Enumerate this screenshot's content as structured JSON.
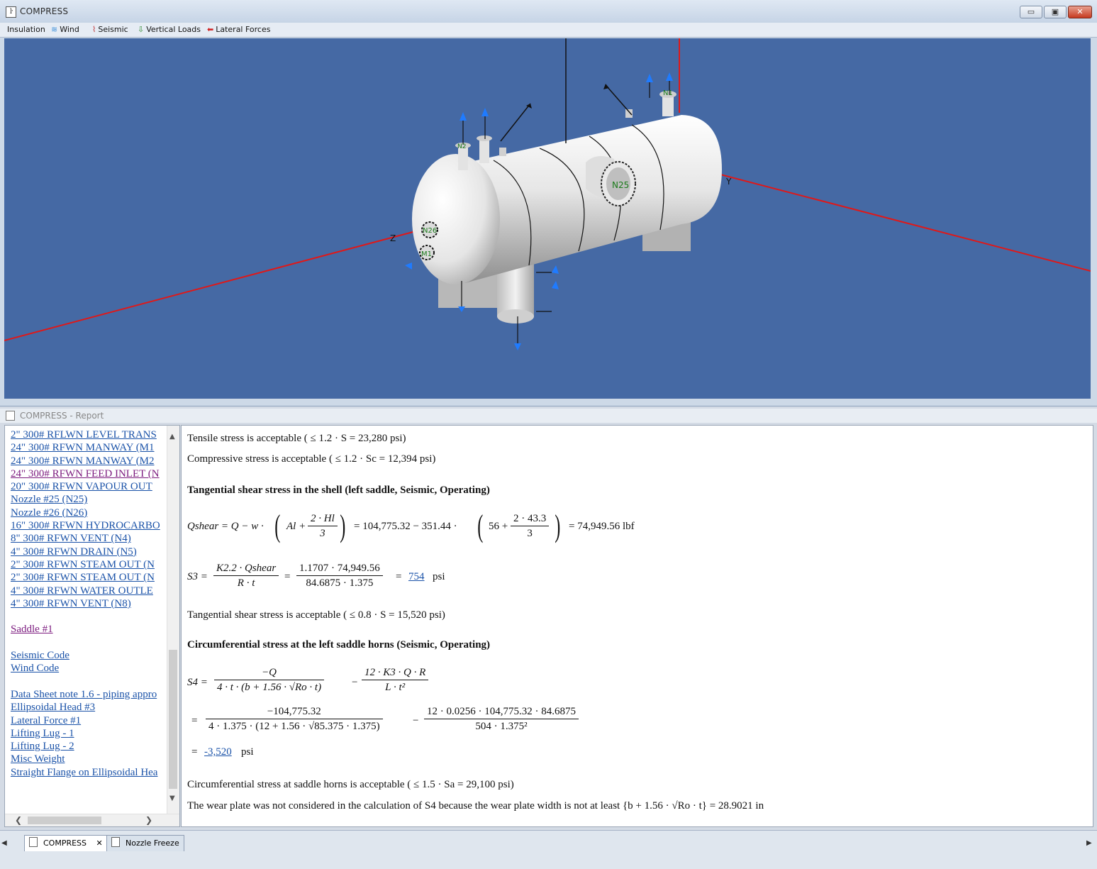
{
  "app": {
    "title": "COMPRESS",
    "icon": "app-icon"
  },
  "window_buttons": {
    "minimize": "▭",
    "maximize": "▣",
    "close": "✕"
  },
  "toolbar": {
    "items": [
      {
        "label": "Insulation",
        "icon": ""
      },
      {
        "label": "Wind",
        "icon": "wind-icon"
      },
      {
        "label": "Seismic",
        "icon": "seismic-icon"
      },
      {
        "label": "Vertical Loads",
        "icon": "down-arrow-icon"
      },
      {
        "label": "Lateral Forces",
        "icon": "left-arrow-icon"
      }
    ]
  },
  "viewport": {
    "labels": {
      "z_axis": "Z",
      "y_axis": "Y",
      "n25": "N25",
      "n26": "N26",
      "m1": "M1",
      "n1": "N1",
      "n2": "N2"
    },
    "colors": {
      "background": "#4569a4",
      "axis": "#e01818",
      "vessel": "#e8e8e8",
      "load_arrow": "#1f7bff"
    }
  },
  "report": {
    "title": "COMPRESS - Report",
    "nav": [
      {
        "label": "2\" 300# RFLWN LEVEL TRANS",
        "visited": false
      },
      {
        "label": "24\" 300# RFWN MANWAY (M1",
        "visited": false
      },
      {
        "label": "24\" 300# RFWN MANWAY (M2",
        "visited": false
      },
      {
        "label": "24\" 300# RFWN FEED INLET (N",
        "visited": true
      },
      {
        "label": "20\" 300# RFWN VAPOUR OUT",
        "visited": false
      },
      {
        "label": "Nozzle #25 (N25)",
        "visited": false
      },
      {
        "label": "Nozzle #26 (N26)",
        "visited": false
      },
      {
        "label": "16\" 300# RFWN HYDROCARBO",
        "visited": false
      },
      {
        "label": "8\" 300# RFWN VENT (N4)",
        "visited": false
      },
      {
        "label": "4\" 300# RFWN DRAIN (N5)",
        "visited": false
      },
      {
        "label": "2\" 300# RFWN STEAM OUT (N",
        "visited": false
      },
      {
        "label": "2\" 300# RFWN STEAM OUT (N",
        "visited": false
      },
      {
        "label": "4\" 300# RFWN WATER OUTLE",
        "visited": false
      },
      {
        "label": "4\" 300# RFWN VENT (N8)",
        "visited": false
      },
      {
        "label": "",
        "visited": false
      },
      {
        "label": "Saddle #1",
        "visited": true
      },
      {
        "label": "",
        "visited": false
      },
      {
        "label": "Seismic Code",
        "visited": false
      },
      {
        "label": "Wind Code",
        "visited": false
      },
      {
        "label": "",
        "visited": false
      },
      {
        "label": "Data Sheet note 1.6 - piping appro",
        "visited": false
      },
      {
        "label": "Ellipsoidal Head #3",
        "visited": false
      },
      {
        "label": "Lateral Force #1",
        "visited": false
      },
      {
        "label": "Lifting Lug - 1",
        "visited": false
      },
      {
        "label": "Lifting Lug - 2",
        "visited": false
      },
      {
        "label": "Misc Weight",
        "visited": false
      },
      {
        "label": "Straight Flange on Ellipsoidal Hea",
        "visited": false
      }
    ],
    "content": {
      "tensile": "Tensile stress is acceptable ( ≤ 1.2 · S = 23,280  psi)",
      "compressive": "Compressive stress is acceptable ( ≤ 1.2 · Sc = 12,394  psi)",
      "heading1": "Tangential shear stress in the shell (left saddle, Seismic, Operating)",
      "qshear_lhs": "Qshear = Q − w ·",
      "qshear_A": "Al +",
      "qshear_frac_num": "2 · Hl",
      "qshear_frac_den": "3",
      "qshear_mid": "= 104,775.32 − 351.44 ·",
      "qshear_56": "56 +",
      "qshear_frac2_num": "2 · 43.3",
      "qshear_frac2_den": "3",
      "qshear_result": "= 74,949.56  lbf",
      "s3_lhs": "S3 =",
      "s3_frac1_num": "K2.2 · Qshear",
      "s3_frac1_den": "R · t",
      "s3_eq": "=",
      "s3_frac2_num": "1.1707 · 74,949.56",
      "s3_frac2_den": "84.6875 · 1.375",
      "s3_eq2": "=",
      "s3_value": "754",
      "s3_unit": "psi",
      "tangential_ok": "Tangential shear stress is acceptable (  ≤ 0.8 · S = 15,520  psi)",
      "heading2": "Circumferential stress at the left saddle horns (Seismic, Operating)",
      "s4_lhs": "S4 =",
      "s4_f1_num": "−Q",
      "s4_f1_den": "4 · t · (b + 1.56 · √Ro · t)",
      "s4_minus": "−",
      "s4_f2_num": "12 · K3 · Q · R",
      "s4_f2_den": "L · t²",
      "s4_eq2": "=",
      "s4_f3_num": "−104,775.32",
      "s4_f3_den": "4 · 1.375 · (12 + 1.56 · √85.375 · 1.375)",
      "s4_minus2": "−",
      "s4_f4_num": "12 · 0.0256 · 104,775.32 · 84.6875",
      "s4_f4_den": "504 · 1.375²",
      "s4_eq3": "=",
      "s4_value": "-3,520",
      "s4_unit": "psi",
      "circ_ok": "Circumferential stress at saddle horns is acceptable ( ≤ 1.5 · Sa = 29,100  psi)",
      "wear_plate": "The wear plate was not considered in the calculation of S4 because the wear plate width is not at least {b + 1.56 · √Ro · t} = 28.9021   in"
    }
  },
  "tabs": [
    {
      "label": "COMPRESS",
      "close": "✕",
      "active": true
    },
    {
      "label": "Nozzle Freeze",
      "active": false
    }
  ]
}
